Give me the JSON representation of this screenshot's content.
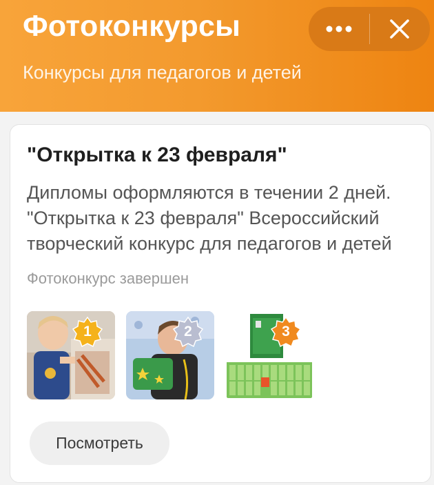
{
  "header": {
    "title": "Фотоконкурсы",
    "subtitle": "Конкурсы для педагогов и детей",
    "more_icon": "more-horizontal-icon",
    "close_icon": "close-icon",
    "accent_color": "#f39a2e"
  },
  "card": {
    "title": "\"Открытка к 23 февраля\"",
    "description": "Дипломы оформляются в течении 2 дней. \"Открытка к 23 февраля\" Всероссийский творческий конкурс для педагогов и детей",
    "status": "Фотоконкурс завершен",
    "winners": [
      {
        "place": "1",
        "badge_color": "#f5b21b"
      },
      {
        "place": "2",
        "badge_color": "#b9bdd0"
      },
      {
        "place": "3",
        "badge_color": "#f08a1f"
      }
    ],
    "view_button": "Посмотреть"
  }
}
